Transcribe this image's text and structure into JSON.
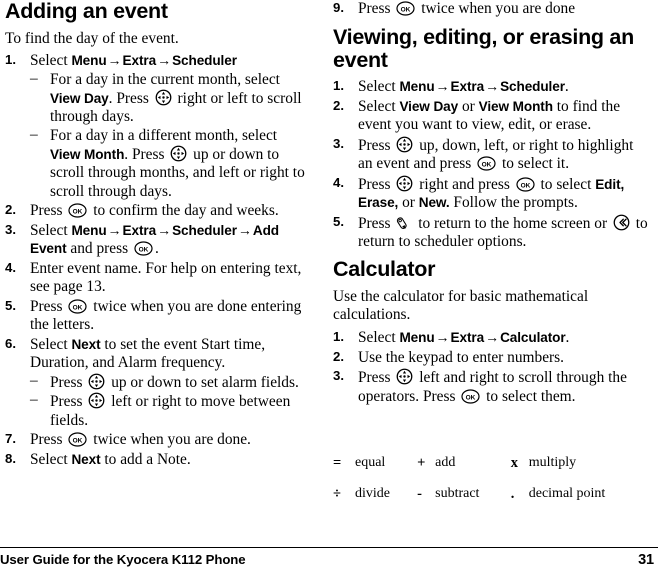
{
  "document": {
    "footer_text": "User Guide for the Kyocera K112 Phone",
    "page_number": "31"
  },
  "icons": {
    "nav_key": "navigation-key-icon",
    "ok_key": "ok-key-icon",
    "end_key": "end-call-key-icon",
    "back_key": "back-key-icon",
    "ok_label": "OK"
  },
  "left_column": {
    "heading": "Adding an event",
    "intro": "To find the day of the event.",
    "steps": {
      "s1": {
        "num": "1.",
        "lead": "Select ",
        "menu": "Menu",
        "arrow1": "→",
        "extra": "Extra",
        "arrow2": "→",
        "scheduler": "Scheduler",
        "sub1": {
          "dash": "–",
          "part1": "For a day in the current month, select ",
          "bold1": "View Day",
          "part2": ". Press ",
          "part3": " right or left to scroll through days."
        },
        "sub2": {
          "dash": "–",
          "part1": "For a day in a different month, select ",
          "bold1": "View Month",
          "part2": ". Press ",
          "part3": " up or down to scroll through months, and left or right to scroll through days."
        }
      },
      "s2": {
        "num": "2.",
        "part1": "Press ",
        "part2": " to confirm the day and weeks."
      },
      "s3": {
        "num": "3.",
        "lead": "Select ",
        "menu": "Menu",
        "arrow1": "→",
        "extra": "Extra",
        "arrow2": "→",
        "scheduler": "Scheduler",
        "arrow3": "→",
        "add_event": "Add Event",
        "tail": " and press ",
        "end": "."
      },
      "s4": {
        "num": "4.",
        "text": "Enter event name. For help on entering text, see page 13."
      },
      "s5": {
        "num": "5.",
        "part1": "Press ",
        "part2": " twice when you are done entering the letters."
      },
      "s6": {
        "num": "6.",
        "part1": "Select ",
        "bold1": "Next",
        "part2": " to set the event Start time, Duration, and Alarm frequency.",
        "sub1": {
          "dash": "–",
          "part1": "Press ",
          "part2": " up or down to set alarm fields."
        },
        "sub2": {
          "dash": "–",
          "part1": "Press ",
          "part2": " left or right to move between fields."
        }
      },
      "s7": {
        "num": "7.",
        "part1": "Press ",
        "part2": " twice when you are done."
      },
      "s8": {
        "num": "8.",
        "part1": "Select ",
        "bold1": "Next",
        "part2": " to add a Note."
      }
    }
  },
  "right_column": {
    "step9": {
      "num": "9.",
      "part1": "Press ",
      "part2": " twice when you are done"
    },
    "heading_viewing": "Viewing, editing, or erasing an event",
    "viewing_steps": {
      "v1": {
        "num": "1.",
        "lead": "Select ",
        "menu": "Menu",
        "arrow1": "→",
        "extra": "Extra",
        "arrow2": "→",
        "scheduler": "Scheduler",
        "end": "."
      },
      "v2": {
        "num": "2.",
        "part1": "Select ",
        "bold1": "View Day",
        "part2": " or ",
        "bold2": "View Month",
        "part3": " to find the event you want to view, edit, or erase."
      },
      "v3": {
        "num": "3.",
        "part1": "Press ",
        "part2": " up, down, left, or right to highlight an event and press ",
        "part3": " to select it."
      },
      "v4": {
        "num": "4.",
        "part1": "Press ",
        "part2": " right and press ",
        "part3": " to select ",
        "bold1": "Edit, Erase,",
        "part4": " or ",
        "bold2": "New.",
        "part5": " Follow the prompts."
      },
      "v5": {
        "num": "5.",
        "part1": "Press ",
        "part2": " to return to the home screen or ",
        "part3": " to return to scheduler options."
      }
    },
    "heading_calculator": "Calculator",
    "calc_intro": "Use the calculator for basic mathematical calculations.",
    "calc_steps": {
      "c1": {
        "num": "1.",
        "lead": "Select ",
        "menu": "Menu",
        "arrow1": "→",
        "extra": "Extra",
        "arrow2": "→",
        "calculator": "Calculator",
        "end": "."
      },
      "c2": {
        "num": "2.",
        "text": "Use the keypad to enter numbers."
      },
      "c3": {
        "num": "3.",
        "part1": "Press ",
        "part2": " left and right to scroll through the operators. Press ",
        "part3": " to select them."
      }
    },
    "operator_table": {
      "rows": [
        [
          {
            "symbol": "=",
            "label": "equal"
          },
          {
            "symbol": "+",
            "label": "add"
          },
          {
            "symbol": "x",
            "label": "multiply"
          }
        ],
        [
          {
            "symbol": "÷",
            "label": "divide"
          },
          {
            "symbol": "-",
            "label": "subtract"
          },
          {
            "symbol": ".",
            "label": "decimal point"
          }
        ]
      ]
    }
  }
}
